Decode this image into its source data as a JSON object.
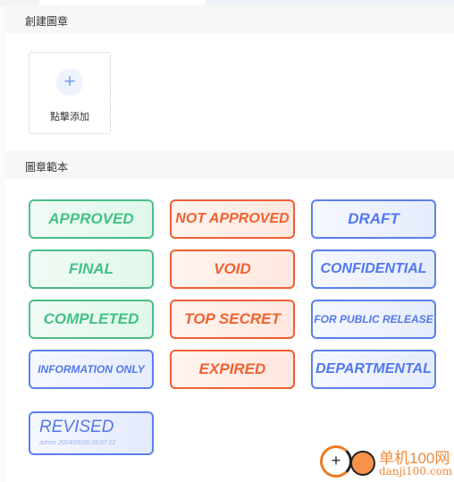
{
  "create_section": {
    "title": "創建圖章",
    "add_label": "點擊添加"
  },
  "templates_section": {
    "title": "圖章範本"
  },
  "stamps": [
    {
      "label": "APPROVED",
      "color": "green"
    },
    {
      "label": "NOT APPROVED",
      "color": "orange"
    },
    {
      "label": "DRAFT",
      "color": "blue"
    },
    {
      "label": "FINAL",
      "color": "green"
    },
    {
      "label": "VOID",
      "color": "orange"
    },
    {
      "label": "CONFIDENTIAL",
      "color": "blue"
    },
    {
      "label": "COMPLETED",
      "color": "green"
    },
    {
      "label": "TOP SECRET",
      "color": "orange"
    },
    {
      "label": "FOR PUBLIC RELEASE",
      "color": "blue"
    },
    {
      "label": "INFORMATION ONLY",
      "color": "blue"
    },
    {
      "label": "EXPIRED",
      "color": "orange"
    },
    {
      "label": "DEPARTMENTAL",
      "color": "blue"
    }
  ],
  "revised": {
    "label": "REVISED",
    "subtext": "admin 2024/06/08,09:07:12"
  },
  "colors": {
    "green": "#43c185",
    "orange": "#f0622f",
    "blue": "#5278ec"
  },
  "watermark": {
    "name": "单机100网",
    "url": "danji100.com"
  }
}
